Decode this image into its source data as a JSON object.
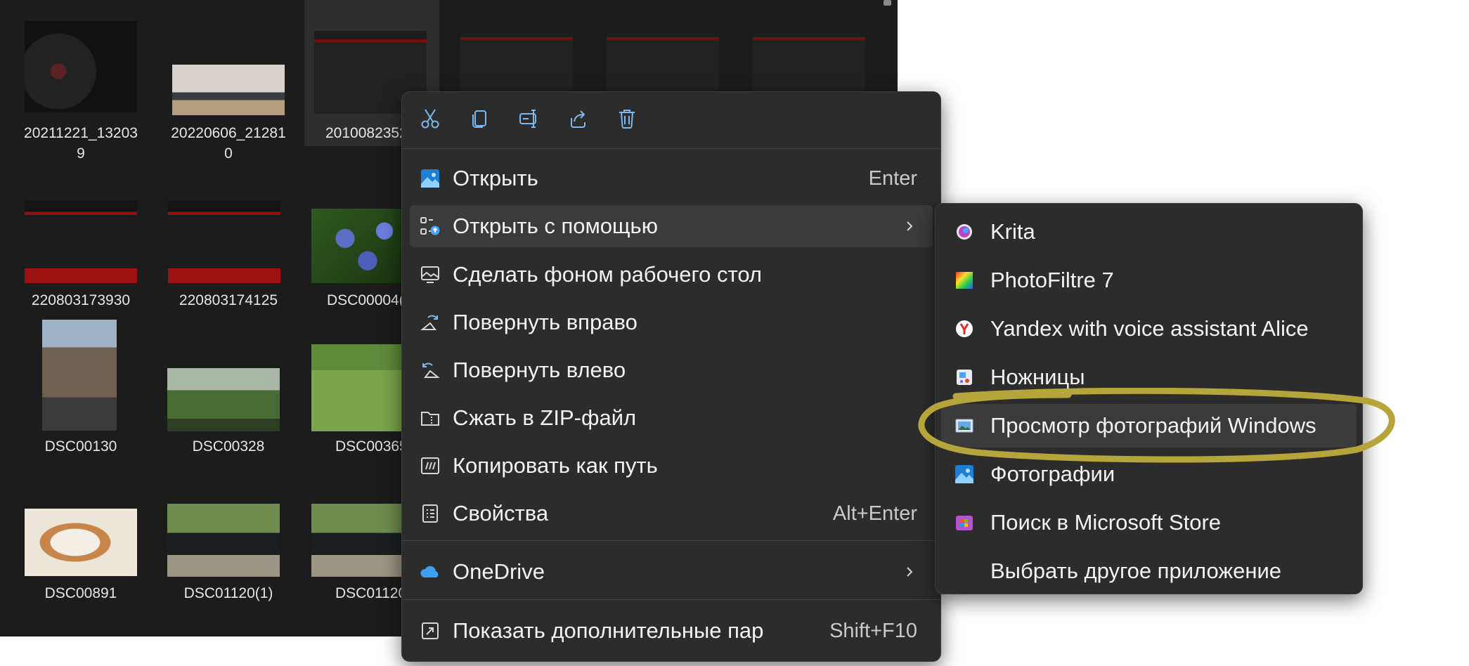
{
  "explorer": {
    "files": [
      {
        "name": "20211221_13203\n9",
        "art": "turntable"
      },
      {
        "name": "20220606_21281\n0",
        "art": "desk"
      },
      {
        "name": "2010082352",
        "art": "ui",
        "selected": true
      },
      {
        "name": "",
        "art": "ui"
      },
      {
        "name": "",
        "art": "ui"
      },
      {
        "name": "",
        "art": "ui"
      },
      {
        "name": "220803173930",
        "art": "ui-red"
      },
      {
        "name": "220803174125",
        "art": "ui-red"
      },
      {
        "name": "DSC00004(1",
        "art": "flowers"
      },
      {
        "name": "DSC00130",
        "art": "street"
      },
      {
        "name": "DSC00328",
        "art": "garden"
      },
      {
        "name": "DSC00365",
        "art": "field"
      },
      {
        "name": "DSC00891",
        "art": "cat"
      },
      {
        "name": "DSC01120(1)",
        "art": "cars"
      },
      {
        "name": "DSC01120",
        "art": "cars"
      }
    ]
  },
  "context_menu": {
    "toolbar": [
      {
        "icon": "scissors-icon",
        "action": "cut"
      },
      {
        "icon": "copy-icon",
        "action": "copy"
      },
      {
        "icon": "rename-icon",
        "action": "rename"
      },
      {
        "icon": "share-icon",
        "action": "share"
      },
      {
        "icon": "trash-icon",
        "action": "delete"
      }
    ],
    "items": [
      {
        "label": "Открыть",
        "shortcut": "Enter",
        "icon": "photos-icon"
      },
      {
        "label": "Открыть с помощью",
        "shortcut": "",
        "icon": "open-with-icon",
        "submenu": true,
        "hover": true
      },
      {
        "label": "Сделать фоном рабочего стол",
        "shortcut": "",
        "icon": "wallpaper-icon"
      },
      {
        "label": "Повернуть вправо",
        "shortcut": "",
        "icon": "rotate-right-icon"
      },
      {
        "label": "Повернуть влево",
        "shortcut": "",
        "icon": "rotate-left-icon"
      },
      {
        "label": "Сжать в ZIP-файл",
        "shortcut": "",
        "icon": "zip-icon"
      },
      {
        "label": "Копировать как путь",
        "shortcut": "",
        "icon": "copy-path-icon"
      },
      {
        "label": "Свойства",
        "shortcut": "Alt+Enter",
        "icon": "properties-icon"
      }
    ],
    "onedrive": {
      "label": "OneDrive",
      "icon": "onedrive-icon"
    },
    "more": {
      "label": "Показать дополнительные пар",
      "shortcut": "Shift+F10",
      "icon": "more-options-icon"
    }
  },
  "submenu": {
    "items": [
      {
        "label": "Krita",
        "icon": "krita-icon"
      },
      {
        "label": "PhotoFiltre 7",
        "icon": "photofiltre-icon"
      },
      {
        "label": "Yandex with voice assistant Alice",
        "icon": "yandex-icon"
      },
      {
        "label": "Ножницы",
        "icon": "snipping-tool-icon"
      },
      {
        "label": "Просмотр фотографий Windows",
        "icon": "photo-viewer-icon",
        "hover": true
      },
      {
        "label": "Фотографии",
        "icon": "photos-icon"
      },
      {
        "label": "Поиск в Microsoft Store",
        "icon": "store-icon"
      },
      {
        "label": "Выбрать другое приложение",
        "icon": ""
      }
    ]
  },
  "colors": {
    "annotation": "#b5a53a",
    "menu_bg": "#2c2c2c",
    "explorer_bg": "#1c1c1c"
  }
}
